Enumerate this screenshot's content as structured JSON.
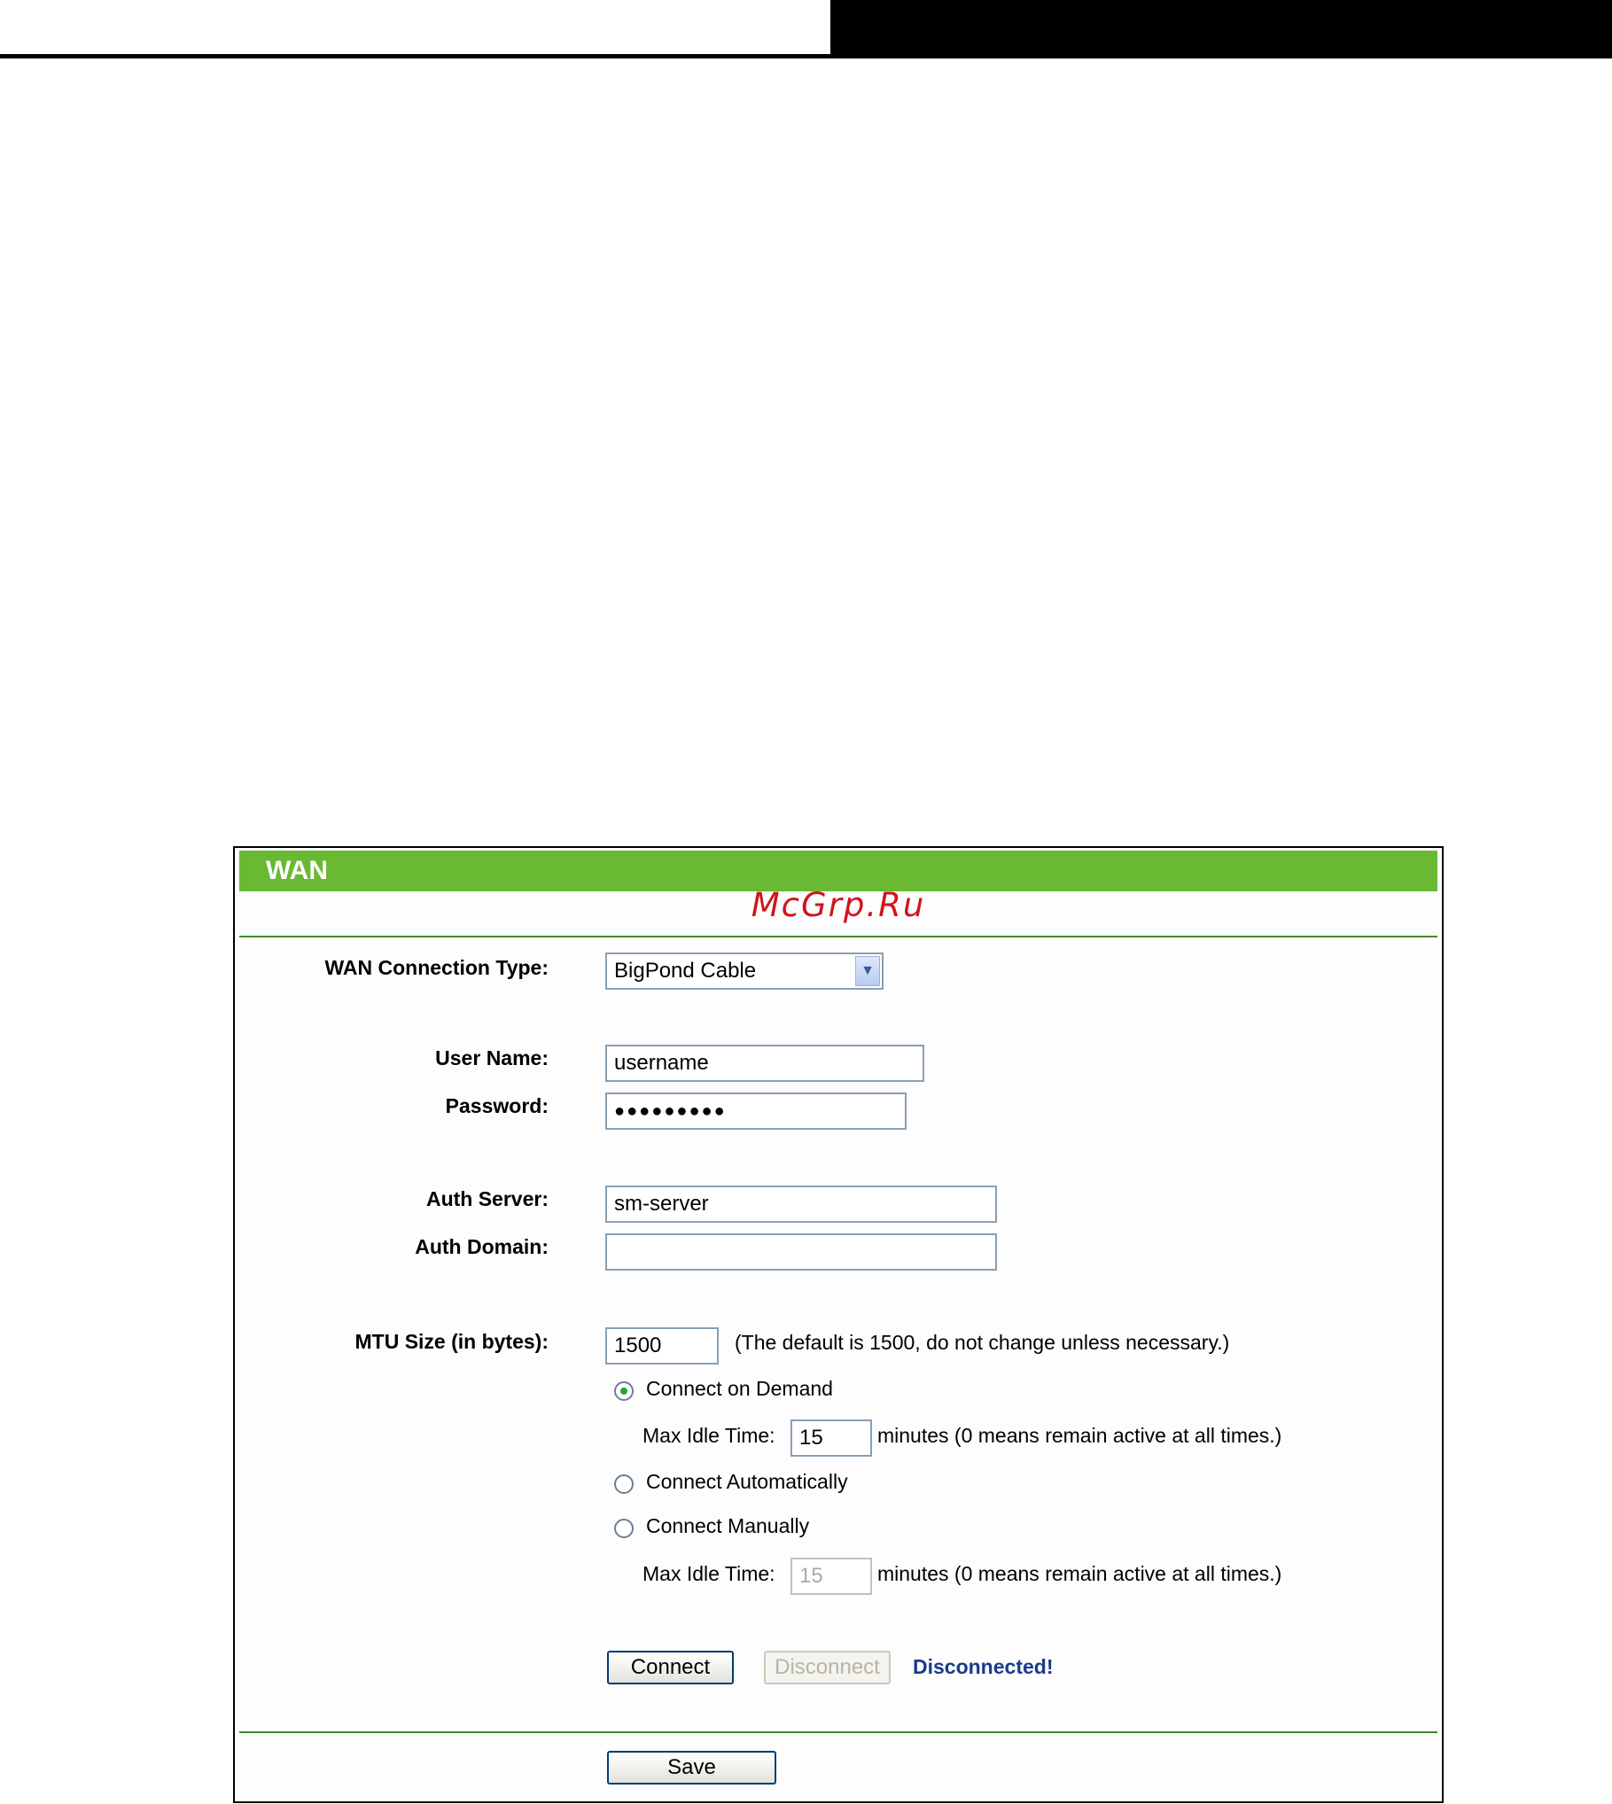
{
  "panel": {
    "title": "WAN",
    "watermark": "McGrp.Ru"
  },
  "form": {
    "connection_type_label": "WAN Connection Type:",
    "connection_type_value": "BigPond Cable",
    "username_label": "User Name:",
    "username_value": "username",
    "password_label": "Password:",
    "password_value": "●●●●●●●●●",
    "auth_server_label": "Auth Server:",
    "auth_server_value": "sm-server",
    "auth_domain_label": "Auth Domain:",
    "auth_domain_value": "",
    "mtu_label": "MTU Size (in bytes):",
    "mtu_value": "1500",
    "mtu_hint": "(The default is 1500, do not change unless necessary.)"
  },
  "connection_modes": {
    "on_demand_label": "Connect on Demand",
    "on_demand_checked": true,
    "max_idle_label": "Max Idle Time:",
    "on_demand_idle_value": "15",
    "idle_hint": "minutes (0 means remain active at all times.)",
    "automatic_label": "Connect Automatically",
    "manual_label": "Connect Manually",
    "manual_idle_value": "15"
  },
  "actions": {
    "connect_label": "Connect",
    "disconnect_label": "Disconnect",
    "status_text": "Disconnected!",
    "save_label": "Save"
  }
}
